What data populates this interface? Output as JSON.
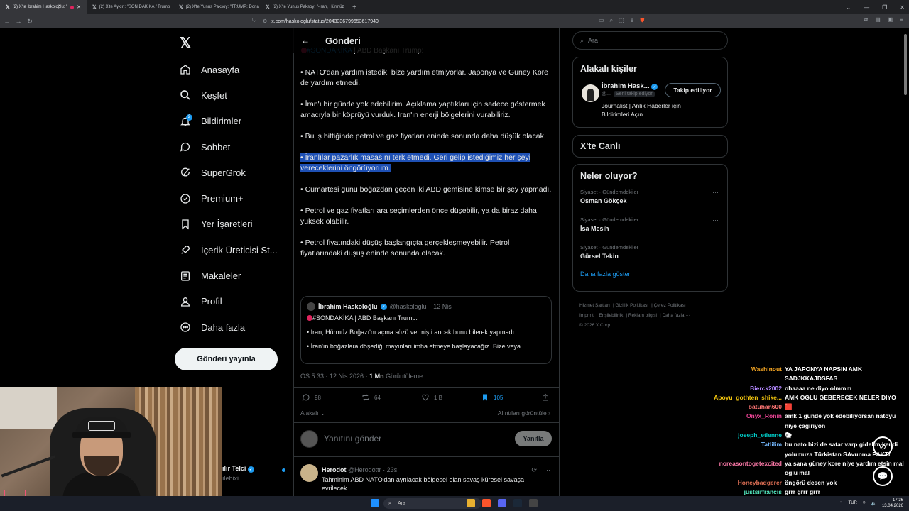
{
  "browser": {
    "tabs": [
      {
        "label": "(2) X'te İbrahim Haskoloğlu: \"",
        "active": true
      },
      {
        "label": "(2) X'te Aykırı: \"SON DAKİKA / Trump",
        "active": false
      },
      {
        "label": "(2) X'te Yunus Paksoy: \"TRUMP: Dona",
        "active": false
      },
      {
        "label": "(2) X'te Yunus Paksoy: \"-İran, Hürmüz",
        "active": false
      }
    ],
    "url": "x.com/haskologlu/status/2043336799653617940"
  },
  "nav": {
    "items": [
      {
        "label": "Anasayfa",
        "icon": "home-icon"
      },
      {
        "label": "Keşfet",
        "icon": "search-icon"
      },
      {
        "label": "Bildirimler",
        "icon": "bell-icon",
        "badge": "2"
      },
      {
        "label": "Sohbet",
        "icon": "chat-icon"
      },
      {
        "label": "SuperGrok",
        "icon": "grok-icon"
      },
      {
        "label": "Premium+",
        "icon": "premium-icon"
      },
      {
        "label": "Yer İşaretleri",
        "icon": "bookmark-icon"
      },
      {
        "label": "İçerik Üreticisi St...",
        "icon": "rocket-icon"
      },
      {
        "label": "Makaleler",
        "icon": "article-icon"
      },
      {
        "label": "Profil",
        "icon": "person-icon"
      },
      {
        "label": "Daha fazla",
        "icon": "more-circle-icon"
      }
    ],
    "post_button": "Gönderi yayınla",
    "account_name": "ılır Telci",
    "account_handle": "ılebixi"
  },
  "post": {
    "header": "Gönderi",
    "partial_tag": "#SONDAKİKA",
    "partial_rest": " | ABD Başkanı Trump:",
    "paragraphs": [
      "• NATO'dan yardım istedik, bize yardım etmiyorlar. Japonya ve Güney Kore de yardım etmedi.",
      "• İran'ı bir günde yok edebilirim. Açıklama yaptıkları için sadece göstermek amacıyla bir köprüyü vurduk. İran'ın enerji bölgelerini vurabiliriz.",
      "• Bu iş bittiğinde petrol ve gaz fiyatları eninde sonunda daha düşük olacak.",
      "• İranlılar pazarlık masasını terk etmedi. Geri gelip istediğimiz her şeyi vereceklerini öngörüyorum.",
      "• Cumartesi günü boğazdan geçen iki ABD gemisine kimse bir şey yapmadı.",
      "• Petrol ve gaz fiyatları ara seçimlerden önce düşebilir, ya da biraz daha yüksek olabilir.",
      "• Petrol fiyatındaki düşüş başlangıçta gerçekleşmeyebilir. Petrol fiyatlarındaki düşüş eninde sonunda olacak."
    ],
    "quote": {
      "name": "İbrahim Haskoloğlu",
      "handle": "@haskologlu",
      "date": "· 12 Nis",
      "line1": "#SONDAKİKA | ABD Başkanı Trump:",
      "line2": "• İran, Hürmüz Boğazı'nı açma sözü vermişti ancak bunu bilerek yapmadı.",
      "line3": "• İran'ın boğazlara döşediği mayınları imha etmeye başlayacağız. Bize veya ..."
    },
    "timestamp": "ÖS 5:33 · 12 Nis 2026 · ",
    "views_count": "1 Mn",
    "views_label": " Görüntüleme",
    "replies": "98",
    "reposts": "64",
    "likes": "1 B",
    "bookmarks": "105",
    "related": "Alakalı",
    "quotes_link": "Alıntıları görüntüle",
    "reply_placeholder": "Yanıtını gönder",
    "reply_button": "Yanıtla"
  },
  "reply_tweet": {
    "name": "Herodot",
    "handle": "@Herodottr",
    "time": "· 23s",
    "text": "Tahminim ABD NATO'dan ayrılacak bölgesel olan savaş küresel savaşa evrilecek."
  },
  "sidebar": {
    "search_placeholder": "Ara",
    "related_title": "Alakalı kişiler",
    "person_name": "İbrahim Hask...",
    "person_handle": "@...",
    "person_follows": "Seni takip ediyor",
    "person_bio": "Journalist | Anlık Haberler için Bildirimleri Açın",
    "follow_button": "Takip ediliyor",
    "live_title": "X'te Canlı",
    "trends_title": "Neler oluyor?",
    "trends": [
      {
        "category": "Siyaset · Gündemdekiler",
        "name": "Osman Gökçek"
      },
      {
        "category": "Siyaset · Gündemdekiler",
        "name": "İsa Mesih"
      },
      {
        "category": "Siyaset · Gündemdekiler",
        "name": "Gürsel Tekin"
      }
    ],
    "show_more": "Daha fazla göster",
    "footer": [
      "Hizmet Şartları",
      "Gizlilik Politikası",
      "Çerez Politikası",
      "Imprint",
      "Erişilebilirlik",
      "Reklam bilgisi",
      "Daha fazla ···",
      "© 2026 X Corp."
    ]
  },
  "chat": [
    {
      "user": "Washinout",
      "color": "#f5a623",
      "text": "YA JAPONYA NAPSIN AMK SADJKKAJDSFAS"
    },
    {
      "user": "Bierck2002",
      "color": "#b388ff",
      "text": "ohaaaa ne diyo olmmm"
    },
    {
      "user": "Apoyu_gothten_shike...",
      "color": "#f1c40f",
      "text": "AMK OGLU GEBERECEK NELER DİYO"
    },
    {
      "user": "batuhan600",
      "color": "#ff7675",
      "text": "🟥"
    },
    {
      "user": "Onyx_Ronin",
      "color": "#e84393",
      "text": "amk 1 günde yok edebiliyorsan natoyu niye çağırıyon"
    },
    {
      "user": "joseph_etienne",
      "color": "#00cec9",
      "text": "🐑"
    },
    {
      "user": "Tatlilim",
      "color": "#74b9ff",
      "text": "bu nato bizi de satar varp gidelim kendi yolumuza Türkistan SAvunma PAKTI"
    },
    {
      "user": "noreasontogetexcited",
      "color": "#fd79a8",
      "text": "ya sana güney kore niye yardım etsin mal oğlu mal"
    },
    {
      "user": "Honeybadgerer",
      "color": "#e17055",
      "text": "öngörü desen yok"
    },
    {
      "user": "justsirfrancis",
      "color": "#55efc4",
      "text": "grrr grrr grrr"
    }
  ],
  "taskbar": {
    "search": "Ara",
    "lang": "TUR",
    "time": "17:36",
    "date": "13.04.2026"
  },
  "colors": {
    "accent": "#1d9bf0",
    "selection": "#1e50b4",
    "background": "#000000"
  }
}
